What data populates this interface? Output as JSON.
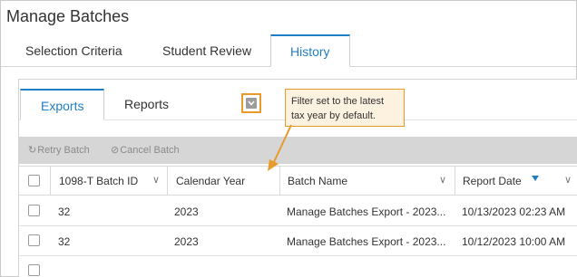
{
  "page": {
    "title": "Manage Batches"
  },
  "main_tabs": [
    {
      "label": "Selection Criteria"
    },
    {
      "label": "Student Review"
    },
    {
      "label": "History"
    }
  ],
  "sub_tabs": [
    {
      "label": "Exports"
    },
    {
      "label": "Reports"
    }
  ],
  "toolbar": {
    "retry_label": "Retry Batch",
    "cancel_label": "Cancel Batch"
  },
  "grid": {
    "columns": [
      {
        "label": "1098-T Batch ID"
      },
      {
        "label": "Calendar Year"
      },
      {
        "label": "Batch Name"
      },
      {
        "label": "Report Date"
      }
    ],
    "rows": [
      {
        "batch_id": "32",
        "year": "2023",
        "name": "Manage Batches Export - 2023...",
        "date": "10/13/2023 02:23 AM"
      },
      {
        "batch_id": "32",
        "year": "2023",
        "name": "Manage Batches Export - 2023...",
        "date": "10/12/2023 10:00 AM"
      }
    ]
  },
  "callout": {
    "line1": "Filter set to the latest",
    "line2": "tax year by default."
  },
  "colors": {
    "accent": "#1f7fc4",
    "callout_border": "#e89a2a",
    "callout_bg": "#fcf2df",
    "toolbar_bg": "#d6d6d6"
  },
  "icons": [
    "retry-icon",
    "cancel-icon",
    "chevron-down-icon",
    "sort-descending-icon",
    "filter-dropdown-icon"
  ]
}
